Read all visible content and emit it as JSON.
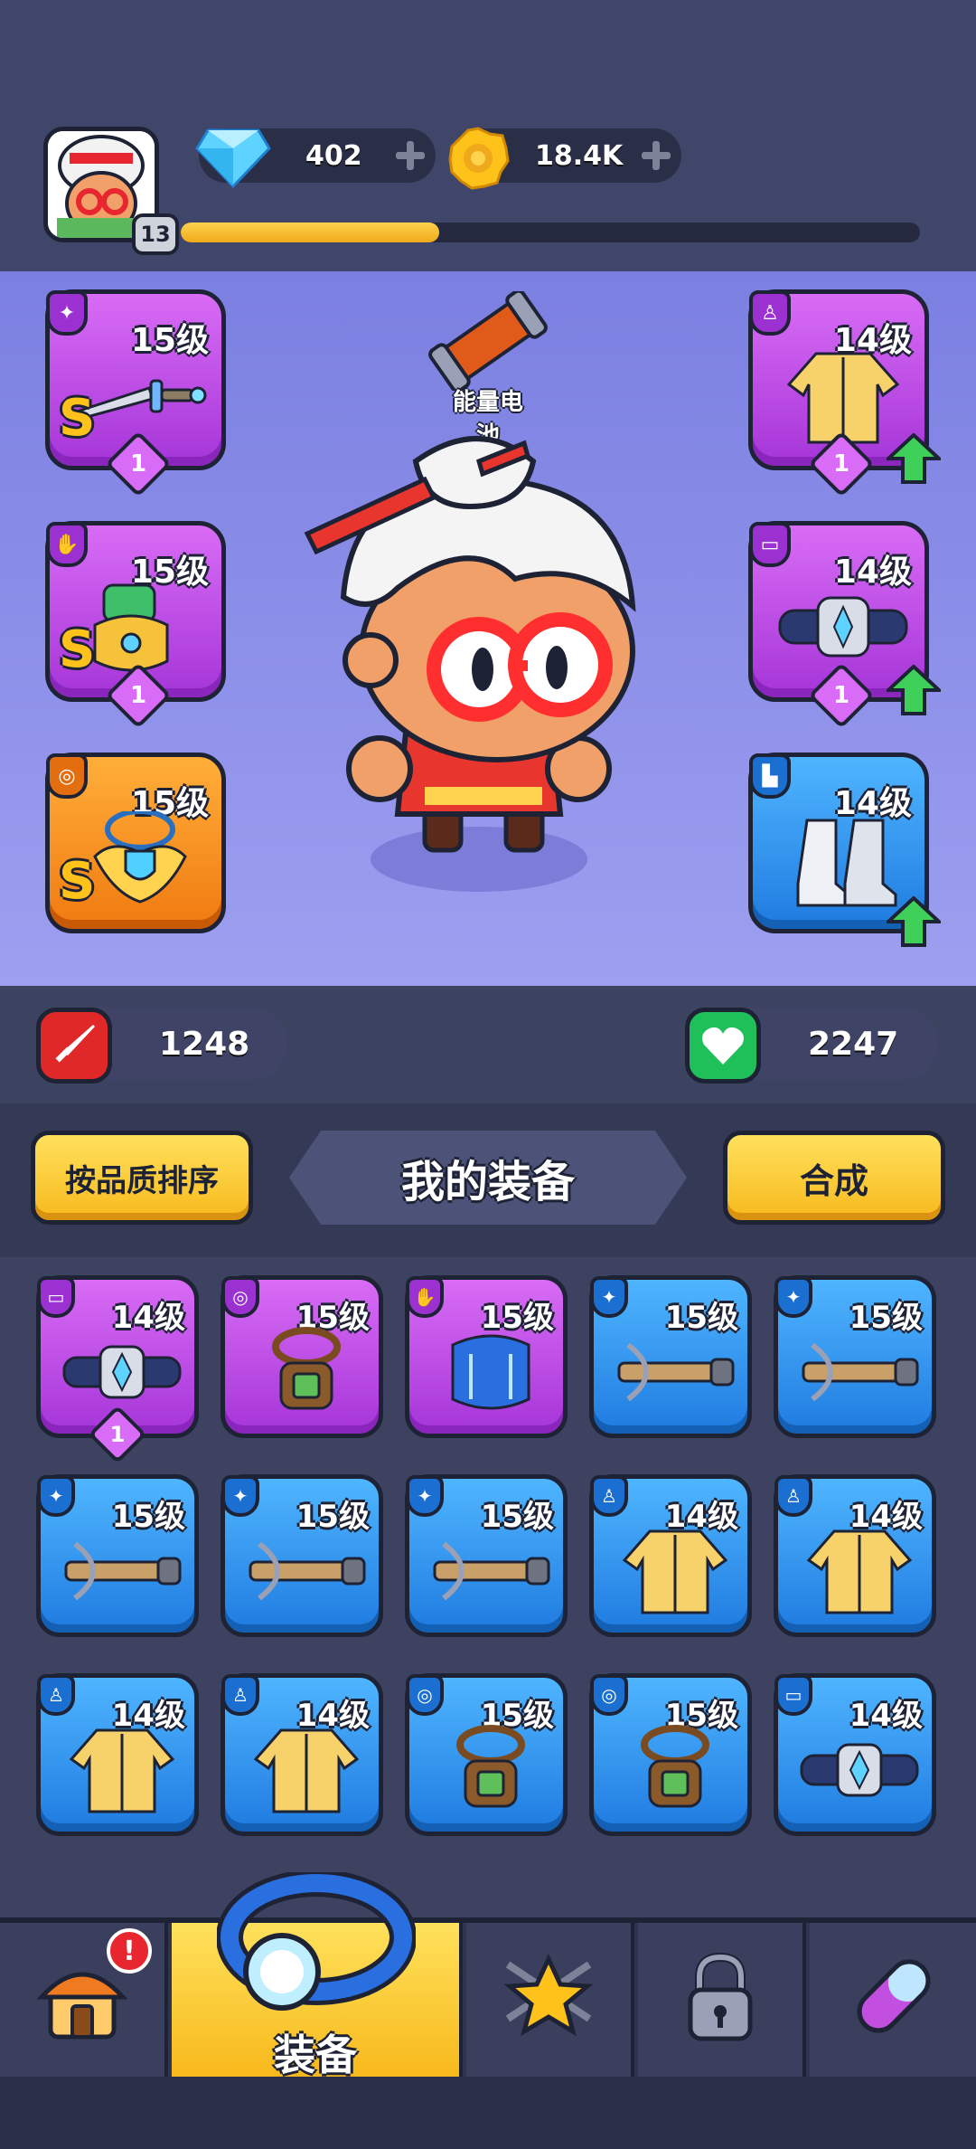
{
  "player": {
    "level": "13",
    "xp_progress": 0.35
  },
  "currencies": {
    "gems": "402",
    "gold": "18.4K"
  },
  "hero": {
    "equipped_item_label": "能量电池"
  },
  "equipped_slots": {
    "weapon": {
      "level": "15级",
      "grade": "S",
      "stars": "1",
      "rarity": "purple"
    },
    "gloves": {
      "level": "15级",
      "grade": "S",
      "stars": "1",
      "rarity": "purple"
    },
    "necklace": {
      "level": "15级",
      "grade": "S",
      "rarity": "orange"
    },
    "armor": {
      "level": "14级",
      "stars": "1",
      "rarity": "purple",
      "upgradable": true
    },
    "belt": {
      "level": "14级",
      "stars": "1",
      "rarity": "purple",
      "upgradable": true
    },
    "boots": {
      "level": "14级",
      "rarity": "blue",
      "upgradable": true
    }
  },
  "stats": {
    "attack": "1248",
    "health": "2247"
  },
  "inventory": {
    "sort_button": "按品质排序",
    "title": "我的装备",
    "merge_button": "合成",
    "items": [
      {
        "level": "14级",
        "rarity": "purple",
        "type": "belt",
        "stars": "1"
      },
      {
        "level": "15级",
        "rarity": "purple",
        "type": "necklace"
      },
      {
        "level": "15级",
        "rarity": "purple",
        "type": "gloves"
      },
      {
        "level": "15级",
        "rarity": "blue",
        "type": "weapon"
      },
      {
        "level": "15级",
        "rarity": "blue",
        "type": "weapon"
      },
      {
        "level": "15级",
        "rarity": "blue",
        "type": "weapon"
      },
      {
        "level": "15级",
        "rarity": "blue",
        "type": "weapon"
      },
      {
        "level": "15级",
        "rarity": "blue",
        "type": "weapon"
      },
      {
        "level": "14级",
        "rarity": "blue",
        "type": "armor"
      },
      {
        "level": "14级",
        "rarity": "blue",
        "type": "armor"
      },
      {
        "level": "14级",
        "rarity": "blue",
        "type": "armor"
      },
      {
        "level": "14级",
        "rarity": "blue",
        "type": "armor"
      },
      {
        "level": "15级",
        "rarity": "blue",
        "type": "necklace"
      },
      {
        "level": "15级",
        "rarity": "blue",
        "type": "necklace"
      },
      {
        "level": "14级",
        "rarity": "blue",
        "type": "belt"
      }
    ]
  },
  "nav": {
    "tabs": [
      {
        "name": "home",
        "label": ""
      },
      {
        "name": "equipment",
        "label": "装备",
        "active": true
      },
      {
        "name": "talents",
        "label": ""
      },
      {
        "name": "locked",
        "label": ""
      },
      {
        "name": "shop",
        "label": ""
      }
    ],
    "home_alert": "!"
  },
  "colors": {
    "rare_purple": "#a535d8",
    "common_blue": "#1f7be0",
    "legendary_orange": "#f07a10",
    "button_yellow": "#f7b91c"
  }
}
